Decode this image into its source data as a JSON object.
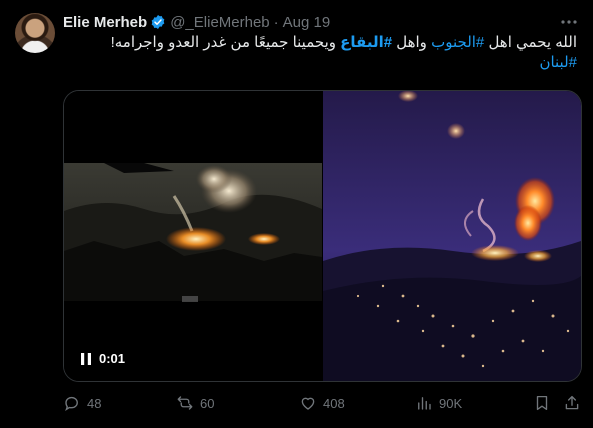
{
  "author": {
    "name": "Elie Merheb",
    "handle": "@_ElieMerheb",
    "separator": "·",
    "date": "Aug 19"
  },
  "tweet": {
    "line1_a": "الله يحمي اهل ",
    "line1_tag1": "#الجنوب",
    "line1_b": " واهل ",
    "line1_tag2": "#البقاع",
    "line1_c": " ويحمينا جميعًا من غدر العدو واجرامه!",
    "line2_tag": "#لبنان"
  },
  "video": {
    "elapsed": "0:01"
  },
  "actions": {
    "replies": "48",
    "reposts": "60",
    "likes": "408",
    "views": "90K"
  },
  "colors": {
    "accent": "#1d9bf0",
    "muted": "#71767b",
    "text": "#e7e9ea",
    "background": "#000000"
  }
}
